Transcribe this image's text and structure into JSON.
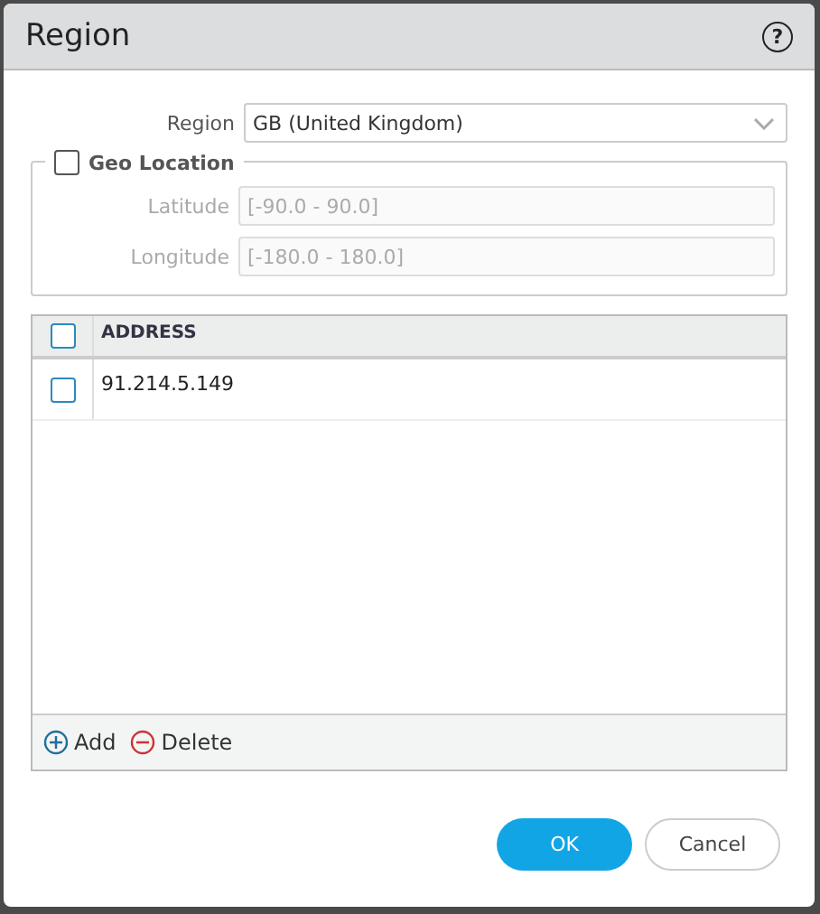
{
  "window": {
    "title": "Region",
    "help": "?"
  },
  "region": {
    "label": "Region",
    "value": "GB (United Kingdom)"
  },
  "geo_location": {
    "label": "Geo Location",
    "checked": false,
    "fields": [
      {
        "label": "Latitude",
        "placeholder": "[-90.0 - 90.0]"
      },
      {
        "label": "Longitude",
        "placeholder": "[-180.0 - 180.0]"
      }
    ]
  },
  "table": {
    "header_checked": false,
    "columns": [
      "ADDRESS"
    ],
    "rows": [
      {
        "address": "91.214.5.149",
        "checked": false
      }
    ]
  },
  "table_actions": [
    {
      "kind": "add",
      "label": "Add"
    },
    {
      "kind": "delete",
      "label": "Delete"
    }
  ],
  "buttons": [
    {
      "kind": "primary",
      "label": "OK"
    },
    {
      "kind": "secondary",
      "label": "Cancel"
    }
  ]
}
